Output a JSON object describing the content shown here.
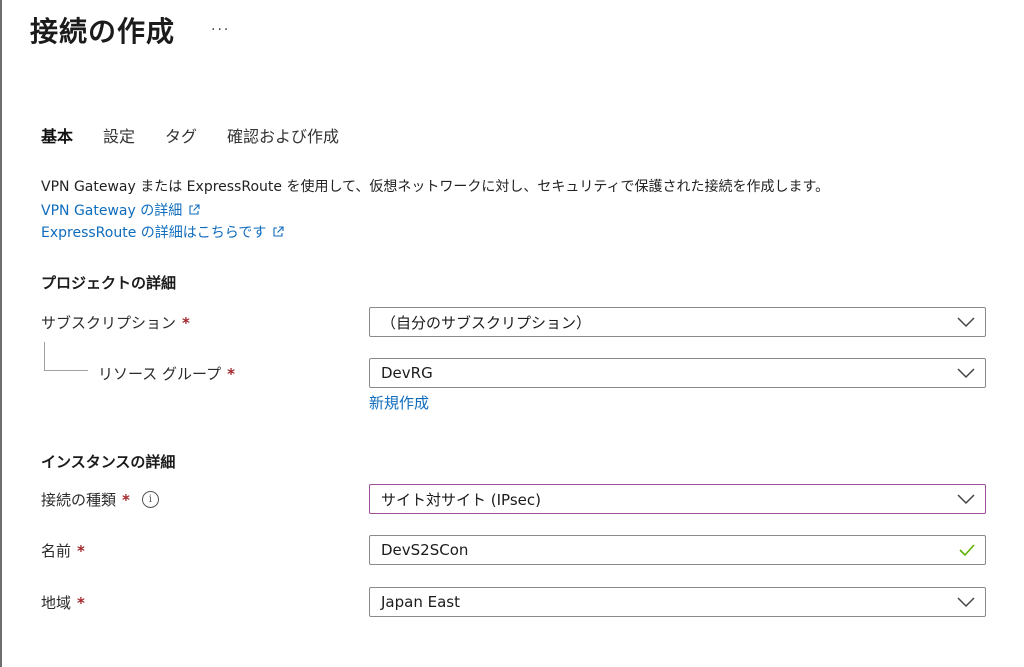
{
  "header": {
    "title": "接続の作成",
    "more_label": "···"
  },
  "tabs": [
    {
      "label": "基本",
      "active": true
    },
    {
      "label": "設定",
      "active": false
    },
    {
      "label": "タグ",
      "active": false
    },
    {
      "label": "確認および作成",
      "active": false
    }
  ],
  "intro": {
    "description": "VPN Gateway または ExpressRoute を使用して、仮想ネットワークに対し、セキュリティで保護された接続を作成します。",
    "links": [
      {
        "label": "VPN Gateway の詳細",
        "icon": "external-link-icon"
      },
      {
        "label": "ExpressRoute の詳細はこちらです",
        "icon": "external-link-icon"
      }
    ]
  },
  "project": {
    "heading": "プロジェクトの詳細",
    "subscription": {
      "label": "サブスクリプション",
      "required": "*",
      "value": "（自分のサブスクリプション）"
    },
    "resource_group": {
      "label": "リソース グループ",
      "required": "*",
      "value": "DevRG",
      "new_link": "新規作成"
    }
  },
  "instance": {
    "heading": "インスタンスの詳細",
    "connection_type": {
      "label": "接続の種類",
      "required": "*",
      "info_icon": "i",
      "value": "サイト対サイト (IPsec)"
    },
    "name": {
      "label": "名前",
      "required": "*",
      "value": "DevS2SCon"
    },
    "region": {
      "label": "地域",
      "required": "*",
      "value": "Japan East"
    }
  },
  "colors": {
    "link": "#0f6cbd",
    "required": "#a4262c",
    "focus_border": "#9b4f96",
    "valid_check": "#5db300"
  }
}
